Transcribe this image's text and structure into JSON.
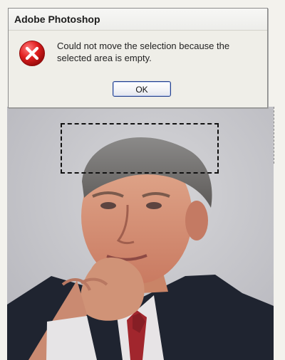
{
  "dialog": {
    "title": "Adobe Photoshop",
    "message": "Could not move the selection because the selected area is empty.",
    "ok_label": "OK",
    "icon": "error-x-icon"
  },
  "colors": {
    "error_red": "#d71a1a",
    "button_border": "#25418c"
  }
}
